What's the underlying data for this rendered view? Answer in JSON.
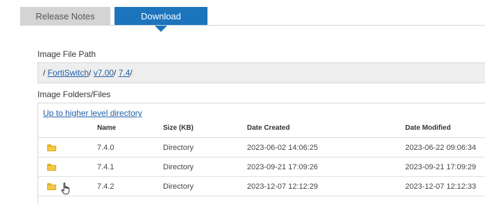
{
  "tabs": [
    {
      "label": "Release Notes",
      "active": false
    },
    {
      "label": "Download",
      "active": true
    }
  ],
  "image_path": {
    "heading": "Image File Path",
    "lead": "/ ",
    "crumbs": [
      {
        "label": "FortiSwitch",
        "trail": "/ "
      },
      {
        "label": "v7.00",
        "trail": "/ "
      },
      {
        "label": "7.4",
        "trail": "/"
      }
    ]
  },
  "files": {
    "heading": "Image Folders/Files",
    "up_link": "Up to higher level directory",
    "columns": {
      "name": "Name",
      "size": "Size (KB)",
      "created": "Date Created",
      "modified": "Date Modified"
    },
    "rows": [
      {
        "icon": "folder-icon",
        "name": "7.4.0",
        "size": "Directory",
        "created": "2023-06-02 14:06:25",
        "modified": "2023-06-22 09:06:34"
      },
      {
        "icon": "folder-icon",
        "name": "7.4.1",
        "size": "Directory",
        "created": "2023-09-21 17:09:26",
        "modified": "2023-09-21 17:09:29"
      },
      {
        "icon": "folder-icon",
        "name": "7.4.2",
        "size": "Directory",
        "created": "2023-12-07 12:12:29",
        "modified": "2023-12-07 12:12:33"
      }
    ]
  },
  "colors": {
    "accent": "#1c75bc",
    "link": "#1f5fa8",
    "tab_inactive": "#d4d4d4",
    "folder": "#f3c944"
  }
}
